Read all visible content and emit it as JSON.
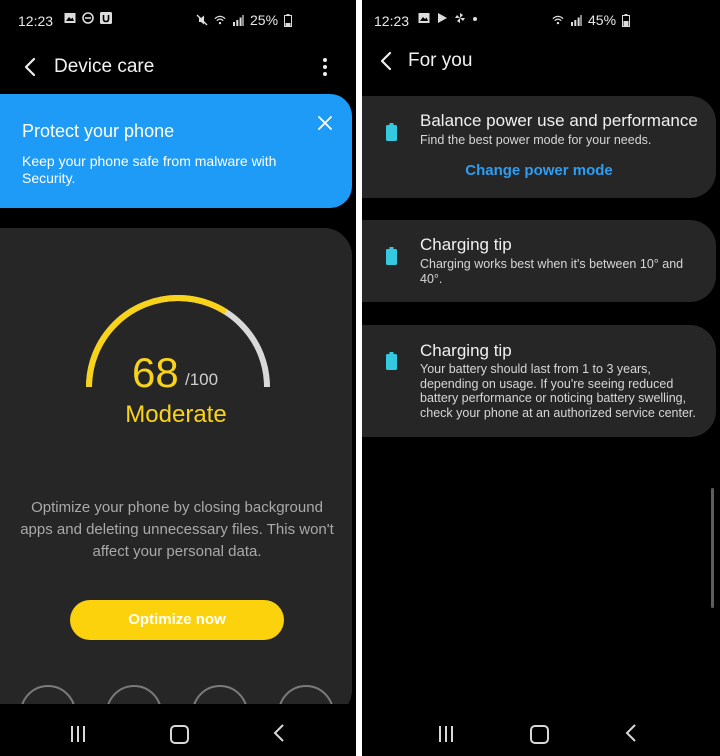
{
  "left": {
    "status": {
      "time": "12:23",
      "battery": "25%"
    },
    "appbar": {
      "title": "Device care"
    },
    "banner": {
      "title": "Protect your phone",
      "body": "Keep your phone safe from malware with Security."
    },
    "score": {
      "value": "68",
      "max": "/100",
      "status": "Moderate",
      "fraction": 0.68
    },
    "description": "Optimize your phone by closing background apps and deleting unnecessary files. This won't affect your personal data.",
    "optimize_label": "Optimize now"
  },
  "right": {
    "status": {
      "time": "12:23",
      "battery": "45%"
    },
    "appbar": {
      "title": "For you"
    },
    "cards": [
      {
        "title": "Balance power use and performance",
        "body": "Find the best power mode for your needs.",
        "link": "Change power mode"
      },
      {
        "title": "Charging tip",
        "body": "Charging works best when it's between 10° and 40°."
      },
      {
        "title": "Charging tip",
        "body": "Your battery should last from 1 to 3 years, depending on usage. If you're seeing reduced battery performance or noticing battery swelling, check your phone at an authorized service center."
      }
    ]
  },
  "colors": {
    "accent_yellow": "#f9d31a",
    "banner_blue": "#1e9bf6",
    "link_blue": "#2e9df2",
    "battery_cyan": "#35c9e0",
    "card_bg": "#262626"
  },
  "icons": [
    "back-arrow-icon",
    "more-options-icon",
    "close-icon",
    "battery-icon",
    "recent-apps-icon",
    "home-icon",
    "nav-back-icon"
  ]
}
